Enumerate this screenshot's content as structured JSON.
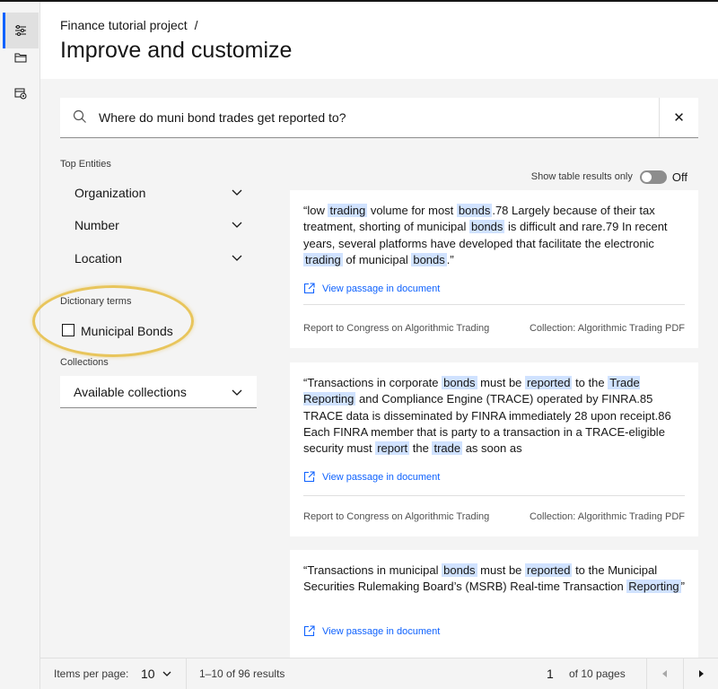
{
  "header": {
    "breadcrumb": "Finance tutorial project",
    "breadcrumb_sep": "/",
    "title": "Improve and customize"
  },
  "rail": {
    "items": [
      "settings-sliders-icon",
      "folder-icon",
      "data-collection-icon"
    ]
  },
  "search": {
    "query": "Where do muni bond trades get reported to?",
    "clear_icon": "✕"
  },
  "facets": {
    "top_entities_label": "Top Entities",
    "items": [
      {
        "label": "Organization"
      },
      {
        "label": "Number"
      },
      {
        "label": "Location"
      }
    ],
    "dictionary_label": "Dictionary terms",
    "dictionary_term": "Municipal Bonds",
    "dictionary_checked": false,
    "collections_label": "Collections",
    "collections_dropdown": "Available collections"
  },
  "toggle": {
    "label": "Show table results only",
    "state": "Off"
  },
  "cards": {
    "link_label": "View passage in document",
    "source": "Report to Congress on Algorithmic Trading",
    "collection": "Collection: Algorithmic Trading PDF",
    "passages": [
      [
        {
          "t": "“low ",
          "h": false
        },
        {
          "t": "trading",
          "h": true
        },
        {
          "t": " volume for most ",
          "h": false
        },
        {
          "t": "bonds",
          "h": true
        },
        {
          "t": ".78 Largely because of their tax treatment, shorting of municipal ",
          "h": false
        },
        {
          "t": "bonds",
          "h": true
        },
        {
          "t": " is difficult and rare.79 In recent years, several platforms have developed that facilitate the electronic ",
          "h": false
        },
        {
          "t": "trading",
          "h": true
        },
        {
          "t": " of municipal ",
          "h": false
        },
        {
          "t": "bonds",
          "h": true
        },
        {
          "t": ".”",
          "h": false
        }
      ],
      [
        {
          "t": "“Transactions in corporate ",
          "h": false
        },
        {
          "t": "bonds",
          "h": true
        },
        {
          "t": " must be ",
          "h": false
        },
        {
          "t": "reported",
          "h": true
        },
        {
          "t": " to the ",
          "h": false
        },
        {
          "t": "Trade Reporting",
          "h": true
        },
        {
          "t": " and Compliance Engine (TRACE) operated by FINRA.85 TRACE data is disseminated by FINRA immediately 28 upon receipt.86 Each FINRA member that is party to a transaction in a TRACE-eligible security must ",
          "h": false
        },
        {
          "t": "report",
          "h": true
        },
        {
          "t": " the ",
          "h": false
        },
        {
          "t": "trade",
          "h": true
        },
        {
          "t": " as soon as",
          "h": false
        }
      ],
      [
        {
          "t": "“Transactions in municipal ",
          "h": false
        },
        {
          "t": "bonds",
          "h": true
        },
        {
          "t": " must be ",
          "h": false
        },
        {
          "t": "reported",
          "h": true
        },
        {
          "t": " to the Municipal Securities Rulemaking Board’s (MSRB) Real-time Transaction ",
          "h": false
        },
        {
          "t": "Reporting",
          "h": true
        },
        {
          "t": "”",
          "h": false
        }
      ]
    ]
  },
  "pagination": {
    "items_per_page_label": "Items per page:",
    "items_per_page": "10",
    "range": "1–10 of 96 results",
    "page": "1",
    "of_pages": "of 10 pages"
  }
}
